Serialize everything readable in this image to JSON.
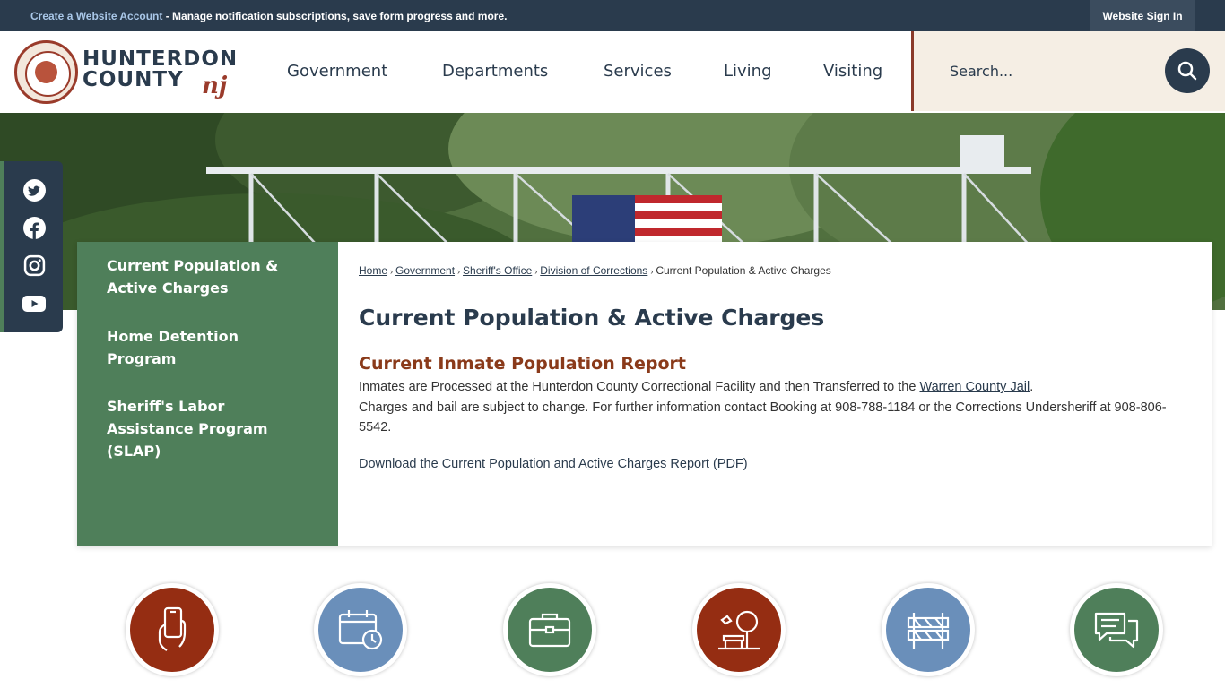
{
  "topbar": {
    "account_link": "Create a Website Account",
    "account_tail": " - Manage notification subscriptions, save form progress and more.",
    "sign_in": "Website Sign In"
  },
  "logo": {
    "line1": "HUNTERDON",
    "line2": "COUNTY",
    "state": "nj"
  },
  "nav": [
    "Government",
    "Departments",
    "Services",
    "Living",
    "Visiting"
  ],
  "search": {
    "placeholder": "Search..."
  },
  "social": [
    "twitter-icon",
    "facebook-icon",
    "instagram-icon",
    "youtube-icon"
  ],
  "sidenav": [
    "Current Population & Active Charges",
    "Home Detention Program",
    "Sheriff's Labor Assistance Program (SLAP)"
  ],
  "breadcrumb": {
    "items": [
      "Home",
      "Government",
      "Sheriff's Office",
      "Division of Corrections"
    ],
    "current": "Current Population & Active Charges"
  },
  "page_title": "Current Population & Active Charges",
  "section": {
    "title": "Current Inmate Population Report",
    "line1_pre": "Inmates are Processed at the Hunterdon County Correctional Facility and then Transferred to the ",
    "line1_link": "Warren County Jail",
    "line1_post": ".",
    "line2": "Charges and bail are subject to change. For further information contact Booking at 908-788-1184 or the Corrections Undersheriff at 908-806-5542.",
    "download": "Download the Current Population and Active Charges Report (PDF)"
  },
  "colors": {
    "navy": "#2a3b4d",
    "green": "#4f7f5a",
    "rust": "#9a3b2b",
    "blue": "#6a8fba"
  },
  "quick_links": [
    {
      "icon": "mobile-hand-icon",
      "color": "#952d12"
    },
    {
      "icon": "calendar-clock-icon",
      "color": "#6a8fba"
    },
    {
      "icon": "briefcase-icon",
      "color": "#4f7f5a"
    },
    {
      "icon": "park-bench-icon",
      "color": "#952d12"
    },
    {
      "icon": "road-barrier-icon",
      "color": "#6a8fba"
    },
    {
      "icon": "chat-bubbles-icon",
      "color": "#4f7f5a"
    }
  ]
}
